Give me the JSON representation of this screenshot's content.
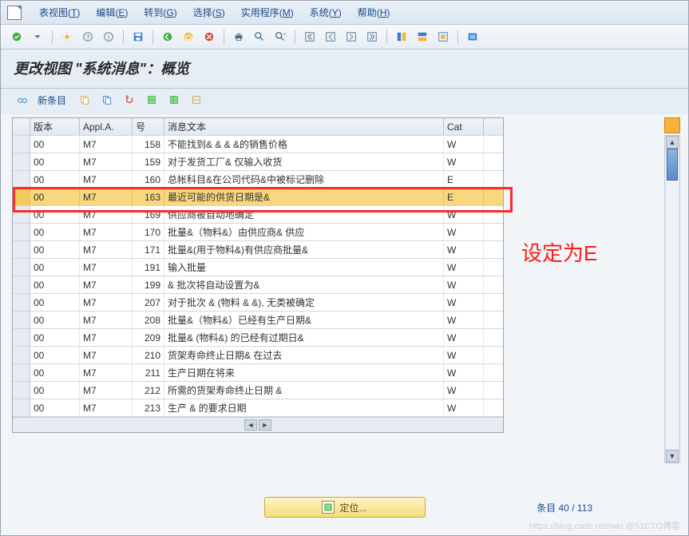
{
  "menu": {
    "items": [
      {
        "label": "表视图",
        "key": "T"
      },
      {
        "label": "编辑",
        "key": "E"
      },
      {
        "label": "转到",
        "key": "G"
      },
      {
        "label": "选择",
        "key": "S"
      },
      {
        "label": "实用程序",
        "key": "M"
      },
      {
        "label": "系统",
        "key": "Y"
      },
      {
        "label": "帮助",
        "key": "H"
      }
    ]
  },
  "title": "更改视图 \"系统消息\"：概览",
  "subtoolbar": {
    "new_entry": "新条目"
  },
  "columns": {
    "version": "版本",
    "appl": "Appl.A.",
    "num": "号",
    "msg": "消息文本",
    "cat": "Cat"
  },
  "rows": [
    {
      "ver": "00",
      "app": "M7",
      "num": "158",
      "msg": "不能找到& & & &的销售价格",
      "cat": "W"
    },
    {
      "ver": "00",
      "app": "M7",
      "num": "159",
      "msg": "对于发货工厂& 仅输入收货",
      "cat": "W"
    },
    {
      "ver": "00",
      "app": "M7",
      "num": "160",
      "msg": "总帐科目&在公司代码&中被标记删除",
      "cat": "E"
    },
    {
      "ver": "00",
      "app": "M7",
      "num": "163",
      "msg": "最近可能的供货日期是&",
      "cat": "E",
      "selected": true
    },
    {
      "ver": "00",
      "app": "M7",
      "num": "169",
      "msg": "供应商被自动地确定",
      "cat": "W"
    },
    {
      "ver": "00",
      "app": "M7",
      "num": "170",
      "msg": "批量&（物料&）由供应商& 供应",
      "cat": "W"
    },
    {
      "ver": "00",
      "app": "M7",
      "num": "171",
      "msg": "批量&(用于物料&)有供应商批量&",
      "cat": "W"
    },
    {
      "ver": "00",
      "app": "M7",
      "num": "191",
      "msg": "输入批量",
      "cat": "W"
    },
    {
      "ver": "00",
      "app": "M7",
      "num": "199",
      "msg": "& 批次将自动设置为&",
      "cat": "W"
    },
    {
      "ver": "00",
      "app": "M7",
      "num": "207",
      "msg": "对于批次 & (物料 & &), 无类被确定",
      "cat": "W"
    },
    {
      "ver": "00",
      "app": "M7",
      "num": "208",
      "msg": "批量&（物料&）已经有生产日期&",
      "cat": "W"
    },
    {
      "ver": "00",
      "app": "M7",
      "num": "209",
      "msg": "批量& (物料&) 的已经有过期日&",
      "cat": "W"
    },
    {
      "ver": "00",
      "app": "M7",
      "num": "210",
      "msg": "货架寿命终止日期& 在过去",
      "cat": "W"
    },
    {
      "ver": "00",
      "app": "M7",
      "num": "211",
      "msg": "生产日期在将来",
      "cat": "W"
    },
    {
      "ver": "00",
      "app": "M7",
      "num": "212",
      "msg": "所需的货架寿命终止日期 &",
      "cat": "W"
    },
    {
      "ver": "00",
      "app": "M7",
      "num": "213",
      "msg": "生产 & 的要求日期",
      "cat": "W"
    }
  ],
  "footer": {
    "position_btn": "定位...",
    "counter": "条目 40 / 113"
  },
  "annotation": "设定为E",
  "watermark": "https://blog.csdn.net/wei @51CTO博客"
}
